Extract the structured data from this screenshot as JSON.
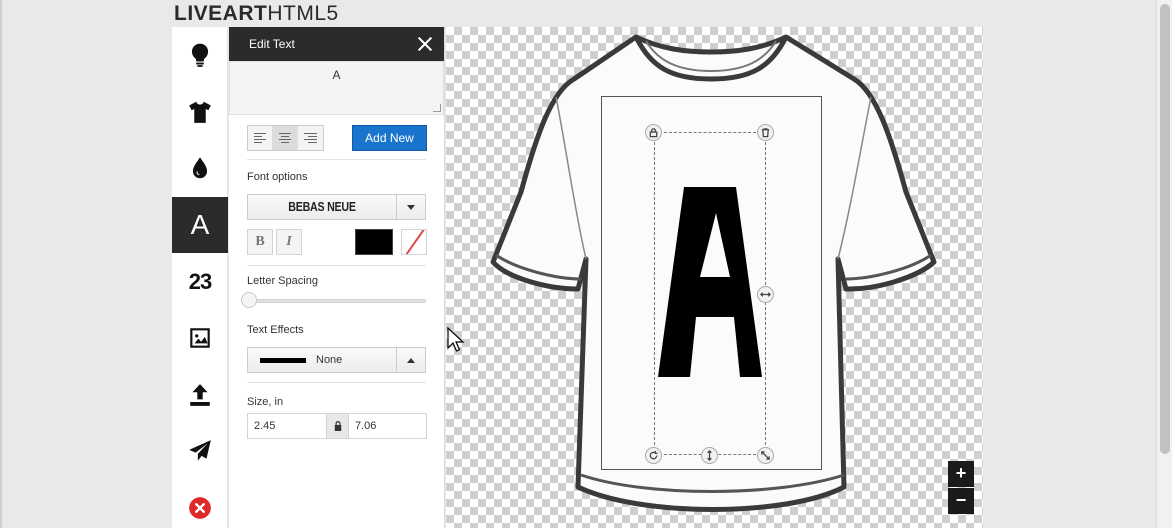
{
  "brand": {
    "bold": "LIVEART",
    "light": "HTML5"
  },
  "toolbar": {
    "tools": [
      {
        "name": "ideas-tool",
        "icon": "lightbulb-icon"
      },
      {
        "name": "products-tool",
        "icon": "tshirt-icon"
      },
      {
        "name": "colors-tool",
        "icon": "droplet-icon"
      },
      {
        "name": "text-tool",
        "icon": "letter-a-icon",
        "label": "A",
        "active": true
      },
      {
        "name": "numbers-tool",
        "icon": "numbers-icon",
        "label": "23"
      },
      {
        "name": "image-tool",
        "icon": "image-icon"
      },
      {
        "name": "upload-tool",
        "icon": "upload-icon"
      },
      {
        "name": "share-tool",
        "icon": "send-icon"
      },
      {
        "name": "clear-tool",
        "icon": "close-circle-icon"
      }
    ]
  },
  "panel": {
    "title": "Edit Text",
    "text_value": "A",
    "add_new_label": "Add New",
    "font_options_label": "Font options",
    "font_name": "BEBAS NEUE",
    "bold_label": "B",
    "italic_label": "I",
    "text_color": "#000000",
    "letter_spacing_label": "Letter Spacing",
    "letter_spacing_value": 0,
    "text_effects_label": "Text Effects",
    "text_effect_value": "None",
    "size_label": "Size, in",
    "width_value": "2.45",
    "height_value": "7.06"
  },
  "canvas": {
    "design_text": "A",
    "zoom_in_label": "+",
    "zoom_out_label": "−"
  },
  "colors": {
    "accent": "#1874cd",
    "dark": "#2b2b2b",
    "danger": "#e02b2b"
  }
}
